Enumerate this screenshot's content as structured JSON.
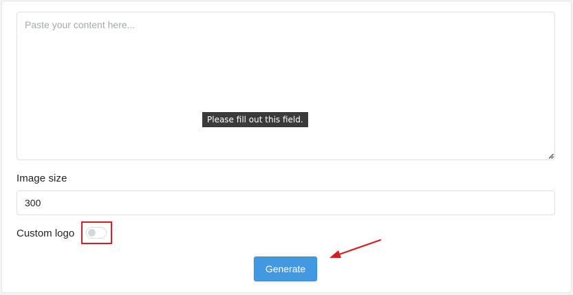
{
  "form": {
    "content": {
      "placeholder": "Paste your content here...",
      "value": "",
      "validation_tooltip": "Please fill out this field."
    },
    "image_size": {
      "label": "Image size",
      "value": "300"
    },
    "custom_logo": {
      "label": "Custom logo",
      "checked": false
    },
    "generate_label": "Generate"
  },
  "annotations": {
    "highlight_color": "#d91c1c",
    "arrow_color": "#d91c1c"
  },
  "colors": {
    "primary_button": "#4299e1",
    "tooltip_bg": "#3a3a3a"
  }
}
